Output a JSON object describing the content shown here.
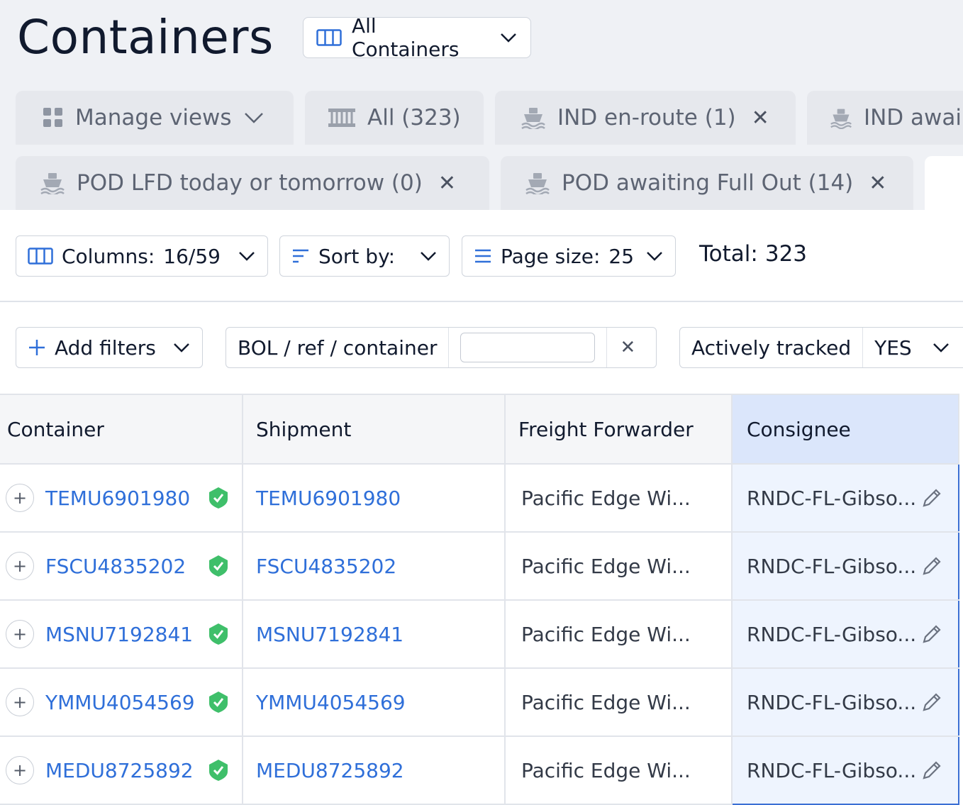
{
  "page": {
    "title": "Containers",
    "view_selector": "All Containers"
  },
  "tabs_row1": [
    {
      "label": "Manage views",
      "icon": "grid-icon"
    },
    {
      "label": "All (323)",
      "icon": "container-icon"
    },
    {
      "label": "IND en-route (1)",
      "icon": "ship-icon"
    },
    {
      "label": "IND awai",
      "icon": "ship-icon"
    }
  ],
  "tabs_row2": [
    {
      "label": "POD LFD today or tomorrow (0)",
      "icon": "ship-icon"
    },
    {
      "label": "POD awaiting Full Out (14)",
      "icon": "ship-icon"
    }
  ],
  "toolbar": {
    "columns_label": "Columns:",
    "columns_value": "16/59",
    "sort_label": "Sort by:",
    "page_size_label": "Page size:",
    "page_size_value": "25",
    "total_label": "Total:",
    "total_value": "323"
  },
  "filters": {
    "add_filters": "Add filters",
    "search_label": "BOL / ref / container",
    "search_value": "",
    "tracked_label": "Actively tracked",
    "tracked_value": "YES"
  },
  "table": {
    "headers": [
      "Container",
      "Shipment",
      "Freight Forwarder",
      "Consignee"
    ],
    "rows": [
      {
        "container": "TEMU6901980",
        "shipment": "TEMU6901980",
        "forwarder": "Pacific Edge Wi...",
        "consignee": "RNDC-FL-Gibso..."
      },
      {
        "container": "FSCU4835202",
        "shipment": "FSCU4835202",
        "forwarder": "Pacific Edge Wi...",
        "consignee": "RNDC-FL-Gibso..."
      },
      {
        "container": "MSNU7192841",
        "shipment": "MSNU7192841",
        "forwarder": "Pacific Edge Wi...",
        "consignee": "RNDC-FL-Gibso..."
      },
      {
        "container": "YMMU4054569",
        "shipment": "YMMU4054569",
        "forwarder": "Pacific Edge Wi...",
        "consignee": "RNDC-FL-Gibso..."
      },
      {
        "container": "MEDU8725892",
        "shipment": "MEDU8725892",
        "forwarder": "Pacific Edge Wi...",
        "consignee": "RNDC-FL-Gibso..."
      }
    ]
  },
  "colors": {
    "link": "#2f6fd9",
    "accent": "#3b6fd4",
    "verified": "#3fbf6a",
    "header_bg": "#eff1f5"
  }
}
